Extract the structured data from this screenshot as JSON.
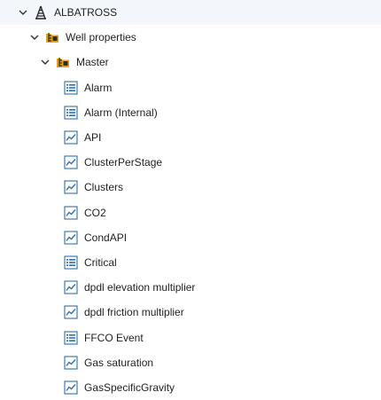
{
  "colors": {
    "icon_blue": "#2f6fb0",
    "folder_orange": "#e3a21a",
    "chevron": "#333333",
    "text": "#1f1f1f"
  },
  "tree": {
    "root": {
      "label": "ALBATROSS",
      "icon": "rig-tower-icon",
      "expanded": true
    },
    "group": {
      "label": "Well properties",
      "icon": "folder-properties-icon",
      "expanded": true
    },
    "subgroup": {
      "label": "Master",
      "icon": "folder-properties-icon",
      "expanded": true
    },
    "items": [
      {
        "label": "Alarm",
        "icon": "list-icon"
      },
      {
        "label": "Alarm (Internal)",
        "icon": "list-icon"
      },
      {
        "label": "API",
        "icon": "trend-chart-icon"
      },
      {
        "label": "ClusterPerStage",
        "icon": "trend-chart-icon"
      },
      {
        "label": "Clusters",
        "icon": "trend-chart-icon"
      },
      {
        "label": "CO2",
        "icon": "trend-chart-icon"
      },
      {
        "label": "CondAPI",
        "icon": "trend-chart-icon"
      },
      {
        "label": "Critical",
        "icon": "list-icon"
      },
      {
        "label": "dpdl elevation multiplier",
        "icon": "trend-chart-icon"
      },
      {
        "label": "dpdl friction multiplier",
        "icon": "trend-chart-icon"
      },
      {
        "label": "FFCO Event",
        "icon": "list-icon"
      },
      {
        "label": "Gas saturation",
        "icon": "trend-chart-icon"
      },
      {
        "label": "GasSpecificGravity",
        "icon": "trend-chart-icon"
      }
    ]
  }
}
